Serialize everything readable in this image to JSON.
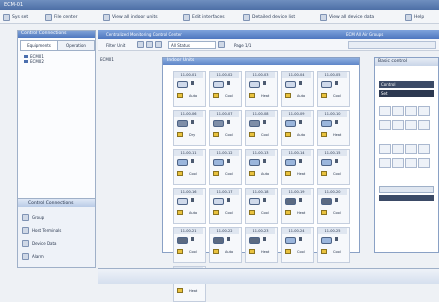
{
  "window": {
    "title": "ECM-01"
  },
  "menu": {
    "items": [
      {
        "label": "Sys set"
      },
      {
        "label": "File center"
      },
      {
        "label": "View all indoor units"
      },
      {
        "label": "Edit interfaces"
      },
      {
        "label": "Detailed device list"
      },
      {
        "label": "View all device data"
      },
      {
        "label": "Help"
      }
    ]
  },
  "sidebar": {
    "title": "Control Connections",
    "tabs": [
      "Equipments",
      "Operation"
    ],
    "tree": [
      "ECM01",
      "ECM02"
    ],
    "bottom_title": "Control Connections",
    "bottom_items": [
      "Group",
      "Host Terminals",
      "Device Data",
      "Alarm"
    ]
  },
  "main": {
    "title": "Centralized Monitoring Control Center",
    "title_right": "ECM All Air Groups",
    "toolbar_label": "Filter Unit",
    "toolbar_field": "All Status",
    "toolbar_page": "Page 1/1",
    "tree_root": "ECM01"
  },
  "panel": {
    "title": "Indoor Units",
    "cards": [
      {
        "code": "11-00-01",
        "mode": "Auto",
        "type": "cassette"
      },
      {
        "code": "11-00-02",
        "mode": "Cool",
        "type": "cassette"
      },
      {
        "code": "11-00-03",
        "mode": "Heat",
        "type": "cassette"
      },
      {
        "code": "11-00-04",
        "mode": "Auto",
        "type": "cassette"
      },
      {
        "code": "11-00-05",
        "mode": "Cool",
        "type": "cassette"
      },
      {
        "code": "11-00-06",
        "mode": "Dry",
        "type": "duct"
      },
      {
        "code": "11-00-07",
        "mode": "Cool",
        "type": "duct"
      },
      {
        "code": "11-00-08",
        "mode": "Cool",
        "type": "duct"
      },
      {
        "code": "11-00-09",
        "mode": "Auto",
        "type": "wall"
      },
      {
        "code": "11-00-10",
        "mode": "Heat",
        "type": "wall"
      },
      {
        "code": "11-00-11",
        "mode": "Cool",
        "type": "wall"
      },
      {
        "code": "11-00-12",
        "mode": "Cool",
        "type": "wall"
      },
      {
        "code": "11-00-13",
        "mode": "Auto",
        "type": "wall"
      },
      {
        "code": "11-00-14",
        "mode": "Heat",
        "type": "wall"
      },
      {
        "code": "11-00-15",
        "mode": "Cool",
        "type": "wall"
      },
      {
        "code": "11-00-16",
        "mode": "Auto",
        "type": "cassette"
      },
      {
        "code": "11-00-17",
        "mode": "Cool",
        "type": "cassette"
      },
      {
        "code": "11-00-18",
        "mode": "Cool",
        "type": "cassette"
      },
      {
        "code": "11-00-19",
        "mode": "Heat",
        "type": "floor"
      },
      {
        "code": "11-00-20",
        "mode": "Cool",
        "type": "floor"
      },
      {
        "code": "11-00-21",
        "mode": "Cool",
        "type": "floor"
      },
      {
        "code": "11-00-22",
        "mode": "Auto",
        "type": "floor"
      },
      {
        "code": "11-00-23",
        "mode": "Heat",
        "type": "floor"
      },
      {
        "code": "11-00-24",
        "mode": "Cool",
        "type": "wall"
      },
      {
        "code": "11-00-25",
        "mode": "Cool",
        "type": "wall"
      },
      {
        "code": "11-00-26",
        "mode": "Heat",
        "type": "floor"
      }
    ]
  },
  "right_panel": {
    "title": "Basic control",
    "rows": [
      "Control",
      "Set"
    ]
  },
  "colors": {
    "accent": "#4e77bf",
    "unit": "#cfd9ea",
    "status": "#e9c23e"
  }
}
